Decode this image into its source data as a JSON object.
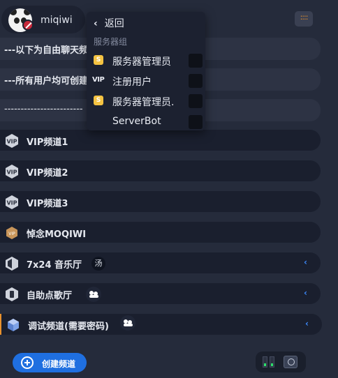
{
  "user": {
    "name": "miqiwi"
  },
  "text_channels": [
    {
      "label": "---以下为自由聊天频"
    },
    {
      "label": "---所有用户均可创建"
    },
    {
      "label": "------------------------"
    }
  ],
  "channels": [
    {
      "label": "VIP频道1",
      "icon": "vip-shield-icon"
    },
    {
      "label": "VIP频道2",
      "icon": "vip-shield-icon"
    },
    {
      "label": "VIP频道3",
      "icon": "vip-shield-icon"
    },
    {
      "label": "悼念MOQIWI",
      "icon": "gold-hex-icon"
    },
    {
      "label": "7x24 音乐厅",
      "icon": "music-hall-icon",
      "badge": "汤"
    },
    {
      "label": "自助点歌厅",
      "icon": "song-room-icon"
    },
    {
      "label": "调试频道(需要密码)",
      "icon": "debug-cube-icon"
    }
  ],
  "dropdown": {
    "back_label": "返回",
    "group_label": "服务器组",
    "items": [
      {
        "name": "服务器管理员",
        "icon": "server-admin-icon",
        "icon_text": "S"
      },
      {
        "name": "注册用户",
        "icon": "vip-icon",
        "icon_text": "VIP"
      },
      {
        "name": "服务器管理员.",
        "icon": "server-admin-icon",
        "icon_text": "S"
      },
      {
        "name": "ServerBot",
        "icon": "",
        "icon_text": ""
      }
    ]
  },
  "bottom": {
    "create_channel_label": "创建频道"
  },
  "colors": {
    "background": "#252b3b",
    "accent": "#1f6fe0",
    "chevron": "#3d8bff",
    "warning": "#e8912d"
  }
}
